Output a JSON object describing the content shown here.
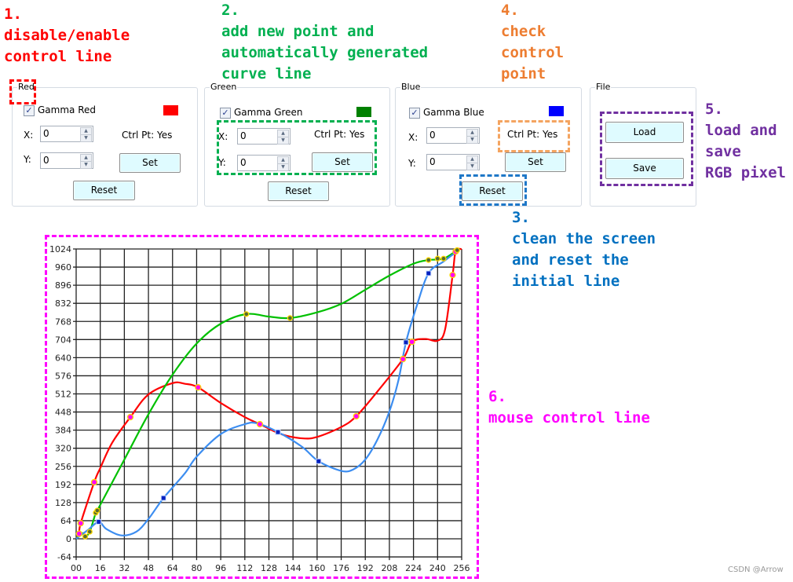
{
  "annotations": [
    {
      "id": "1",
      "color": "#ff0000",
      "lines": [
        "1.",
        "disable/enable",
        "control line"
      ]
    },
    {
      "id": "2",
      "color": "#00b050",
      "lines": [
        "2.",
        "add new point and",
        "automatically generated",
        "curve line"
      ]
    },
    {
      "id": "3",
      "color": "#0070c0",
      "lines": [
        "3.",
        "clean the screen",
        "and reset the",
        "initial line"
      ]
    },
    {
      "id": "4",
      "color": "#ed7d31",
      "lines": [
        "4.",
        "check",
        "control",
        "point"
      ]
    },
    {
      "id": "5",
      "color": "#7030a0",
      "lines": [
        "5.",
        "load and",
        "save",
        "RGB pixel"
      ]
    },
    {
      "id": "6",
      "color": "#ff00ff",
      "lines": [
        "6.",
        "mouse control line"
      ]
    }
  ],
  "panels": {
    "red": {
      "title": "Red",
      "checkbox_label": "Gamma Red",
      "checked": true,
      "swatch": "#ff0000",
      "x_label": "X:",
      "x_value": "0",
      "y_label": "Y:",
      "y_value": "0",
      "ctrl_pt": "Ctrl Pt: Yes",
      "set": "Set",
      "reset": "Reset"
    },
    "green": {
      "title": "Green",
      "checkbox_label": "Gamma Green",
      "checked": true,
      "swatch": "#008000",
      "x_label": "X:",
      "x_value": "0",
      "y_label": "Y:",
      "y_value": "0",
      "ctrl_pt": "Ctrl Pt: Yes",
      "set": "Set",
      "reset": "Reset"
    },
    "blue": {
      "title": "Blue",
      "checkbox_label": "Gamma Blue",
      "checked": true,
      "swatch": "#0000ff",
      "x_label": "X:",
      "x_value": "0",
      "y_label": "Y:",
      "y_value": "0",
      "ctrl_pt": "Ctrl Pt: Yes",
      "set": "Set",
      "reset": "Reset"
    },
    "file": {
      "title": "File",
      "load": "Load",
      "save": "Save"
    }
  },
  "watermark": "CSDN @Arrow",
  "chart_data": {
    "type": "line",
    "xlim": [
      0,
      256
    ],
    "ylim": [
      -64,
      1024
    ],
    "x_ticks": [
      "00",
      "16",
      "32",
      "48",
      "64",
      "80",
      "96",
      "112",
      "128",
      "144",
      "160",
      "176",
      "192",
      "208",
      "224",
      "240",
      "256"
    ],
    "y_ticks": [
      "1024",
      "960",
      "896",
      "832",
      "768",
      "704",
      "640",
      "576",
      "512",
      "448",
      "384",
      "320",
      "256",
      "192",
      "128",
      "64",
      "0",
      "-64"
    ],
    "grid": true,
    "series": [
      {
        "color": "#ff0000",
        "marker": "magenta-circle",
        "points": [
          [
            2,
            18
          ],
          [
            3,
            55
          ],
          [
            12,
            200
          ],
          [
            36,
            430
          ],
          [
            81,
            535
          ],
          [
            122,
            405
          ],
          [
            186,
            433
          ],
          [
            217,
            635
          ],
          [
            223,
            696
          ],
          [
            250,
            932
          ],
          [
            252,
            1015
          ]
        ],
        "curve": [
          [
            0,
            0
          ],
          [
            2,
            18
          ],
          [
            3,
            55
          ],
          [
            12,
            200
          ],
          [
            16,
            250
          ],
          [
            24,
            340
          ],
          [
            36,
            430
          ],
          [
            48,
            510
          ],
          [
            64,
            550
          ],
          [
            72,
            548
          ],
          [
            81,
            535
          ],
          [
            96,
            480
          ],
          [
            112,
            430
          ],
          [
            122,
            405
          ],
          [
            136,
            370
          ],
          [
            150,
            355
          ],
          [
            160,
            360
          ],
          [
            176,
            395
          ],
          [
            186,
            433
          ],
          [
            200,
            520
          ],
          [
            217,
            635
          ],
          [
            223,
            696
          ],
          [
            232,
            706
          ],
          [
            240,
            700
          ],
          [
            245,
            740
          ],
          [
            250,
            932
          ],
          [
            252,
            1015
          ],
          [
            256,
            1024
          ]
        ]
      },
      {
        "color": "#00c000",
        "marker": "olive-circle",
        "points": [
          [
            6,
            8
          ],
          [
            9,
            25
          ],
          [
            13,
            92
          ],
          [
            14,
            100
          ],
          [
            113,
            794
          ],
          [
            142,
            780
          ],
          [
            234,
            985
          ],
          [
            240,
            990
          ],
          [
            244,
            990
          ],
          [
            253,
            1020
          ]
        ],
        "curve": [
          [
            0,
            0
          ],
          [
            4,
            20
          ],
          [
            6,
            8
          ],
          [
            9,
            25
          ],
          [
            13,
            92
          ],
          [
            14,
            100
          ],
          [
            32,
            280
          ],
          [
            48,
            440
          ],
          [
            64,
            580
          ],
          [
            80,
            690
          ],
          [
            96,
            760
          ],
          [
            113,
            794
          ],
          [
            128,
            785
          ],
          [
            142,
            780
          ],
          [
            160,
            800
          ],
          [
            176,
            830
          ],
          [
            192,
            880
          ],
          [
            208,
            930
          ],
          [
            224,
            972
          ],
          [
            234,
            985
          ],
          [
            244,
            990
          ],
          [
            253,
            1020
          ]
        ]
      },
      {
        "color": "#3c8df0",
        "marker": "blue-square",
        "points": [
          [
            15,
            60
          ],
          [
            58,
            144
          ],
          [
            134,
            377
          ],
          [
            161,
            274
          ],
          [
            219,
            694
          ],
          [
            234,
            938
          ]
        ],
        "curve": [
          [
            0,
            0
          ],
          [
            8,
            32
          ],
          [
            15,
            60
          ],
          [
            20,
            35
          ],
          [
            30,
            12
          ],
          [
            40,
            25
          ],
          [
            48,
            70
          ],
          [
            58,
            144
          ],
          [
            72,
            230
          ],
          [
            80,
            290
          ],
          [
            96,
            370
          ],
          [
            112,
            405
          ],
          [
            120,
            408
          ],
          [
            134,
            377
          ],
          [
            150,
            325
          ],
          [
            161,
            274
          ],
          [
            176,
            240
          ],
          [
            184,
            245
          ],
          [
            192,
            280
          ],
          [
            200,
            350
          ],
          [
            208,
            450
          ],
          [
            214,
            560
          ],
          [
            219,
            694
          ],
          [
            226,
            820
          ],
          [
            234,
            938
          ],
          [
            244,
            980
          ],
          [
            254,
            1020
          ]
        ]
      }
    ]
  }
}
